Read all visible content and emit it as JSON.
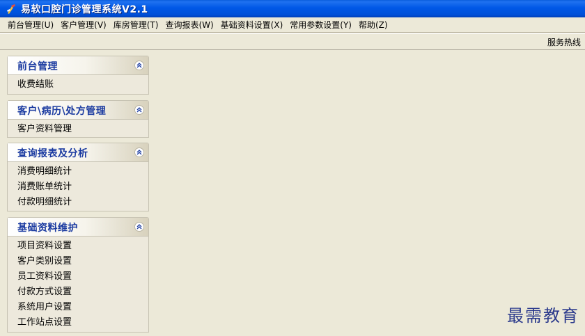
{
  "window": {
    "title": "易软口腔门诊管理系统V2.1"
  },
  "menubar": {
    "items": [
      "前台管理(U)",
      "客户管理(V)",
      "库房管理(T)",
      "查询报表(W)",
      "基础资料设置(X)",
      "常用参数设置(Y)",
      "帮助(Z)"
    ]
  },
  "status": {
    "hotline": "服务热线"
  },
  "sidebar": {
    "panels": [
      {
        "title": "前台管理",
        "items": [
          "收费结账"
        ]
      },
      {
        "title": "客户\\病历\\处方管理",
        "items": [
          "客户资料管理"
        ]
      },
      {
        "title": "查询报表及分析",
        "items": [
          "消费明细统计",
          "消费账单统计",
          "付款明细统计"
        ]
      },
      {
        "title": "基础资料维护",
        "items": [
          "项目资料设置",
          "客户类别设置",
          "员工资料设置",
          "付款方式设置",
          "系统用户设置",
          "工作站点设置"
        ]
      }
    ]
  },
  "watermark": {
    "text": "最需教育"
  },
  "colors": {
    "titlebar": "#0058e6",
    "panel_title": "#1a3aa0",
    "background": "#ece9d8"
  }
}
